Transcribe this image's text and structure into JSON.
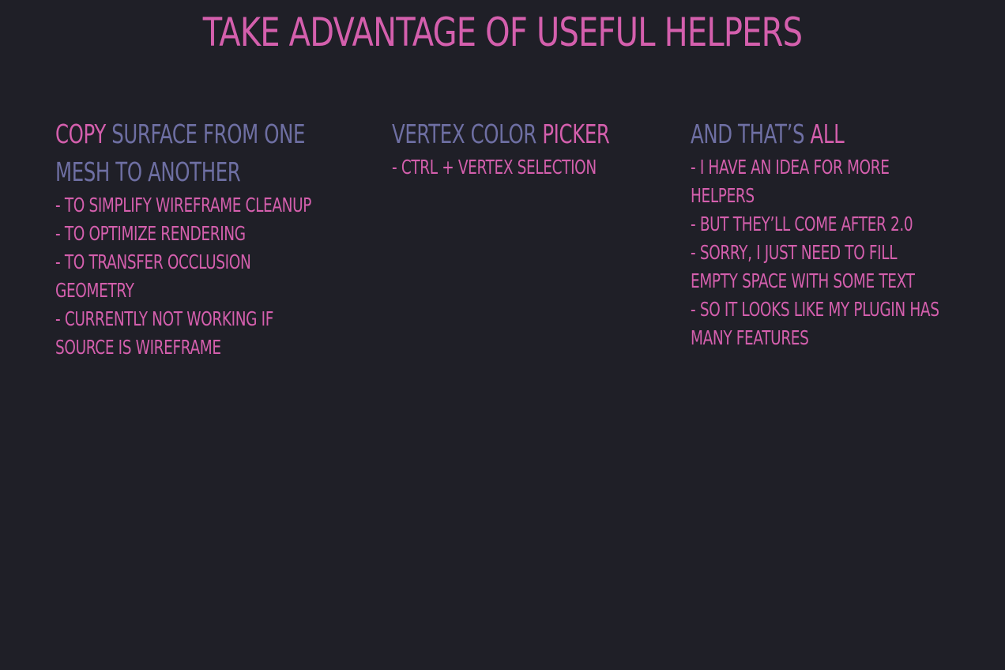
{
  "colors": {
    "background": "#1f1f27",
    "accent_pink": "#d45fad",
    "accent_purple": "#6e6fa3"
  },
  "title": "Take advantage of useful helpers",
  "columns": [
    {
      "heading": {
        "highlight": "Copy",
        "rest": " surface from one mesh to another"
      },
      "items": [
        "- to simplify wireframe cleanup",
        "- to optimize rendering",
        "- to transfer occlusion geometry",
        "- currently not working if source is wireframe"
      ]
    },
    {
      "heading": {
        "rest": "Vertex color ",
        "highlight": "picker"
      },
      "items": [
        "- Ctrl + vertex selection"
      ]
    },
    {
      "heading": {
        "rest": "And that’s ",
        "highlight": "all"
      },
      "items": [
        "- I have an idea for more helpers",
        "- but they’ll come after 2.0",
        "- sorry, I just need to fill empty space with some text",
        "- so it looks like my plugin has many features"
      ]
    }
  ]
}
